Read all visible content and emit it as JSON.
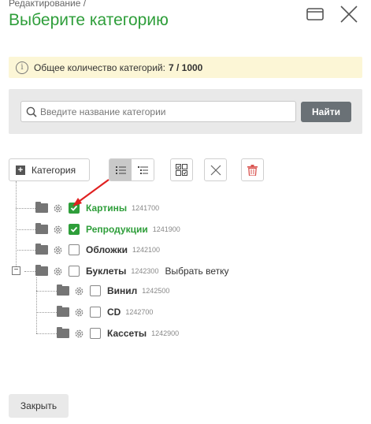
{
  "header": {
    "breadcrumb": "Редактирование /",
    "title": "Выберите категорию"
  },
  "window_controls": {
    "maximize_icon": "maximize-icon",
    "close_icon": "close-icon"
  },
  "info": {
    "icon": "info-icon",
    "text": "Общее количество категорий:",
    "count": "7 / 1000"
  },
  "search": {
    "placeholder": "Введите название категории",
    "value": "",
    "button_label": "Найти"
  },
  "toolbar": {
    "add_category_label": "Категория",
    "view_list_icon": "list-view-icon",
    "view_tree_icon": "tree-view-icon",
    "select_all_icon": "select-all-icon",
    "clear_icon": "clear-selection-icon",
    "delete_icon": "trash-icon"
  },
  "tree": {
    "nodes": [
      {
        "name": "Картины",
        "id": "1241700",
        "checked": true,
        "level": 1,
        "expanded": null
      },
      {
        "name": "Репродукции",
        "id": "1241900",
        "checked": true,
        "level": 1,
        "expanded": null
      },
      {
        "name": "Обложки",
        "id": "1242100",
        "checked": false,
        "level": 1,
        "expanded": null
      },
      {
        "name": "Буклеты",
        "id": "1242300",
        "checked": false,
        "level": 1,
        "expanded": true,
        "action": "Выбрать ветку"
      },
      {
        "name": "Винил",
        "id": "1242500",
        "checked": false,
        "level": 2,
        "expanded": null
      },
      {
        "name": "CD",
        "id": "1242700",
        "checked": false,
        "level": 2,
        "expanded": null
      },
      {
        "name": "Кассеты",
        "id": "1242900",
        "checked": false,
        "level": 2,
        "expanded": null
      }
    ],
    "toggle_symbol": "−"
  },
  "footer": {
    "close_label": "Закрыть"
  },
  "colors": {
    "accent_green": "#2e9e3a",
    "info_bg": "#fcf6d6",
    "panel_bg": "#e9e9e9",
    "find_button": "#6a7176",
    "delete_red": "#d9534f",
    "annotation_arrow": "#e02020"
  }
}
